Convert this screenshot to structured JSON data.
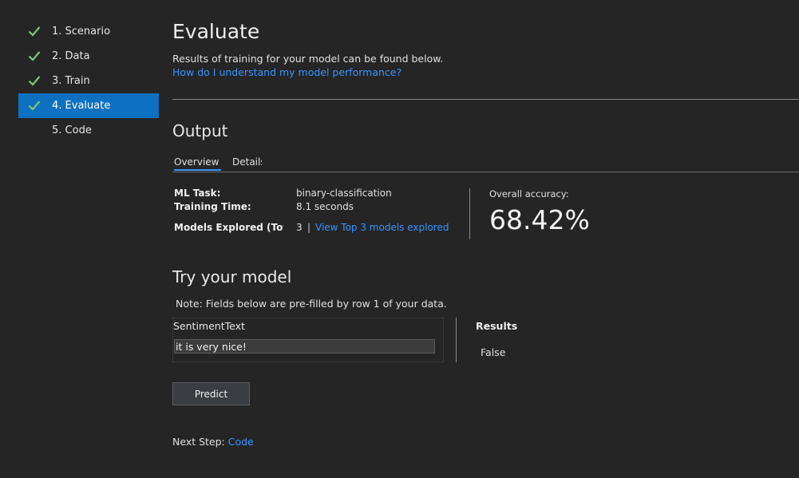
{
  "sidebar": {
    "steps": [
      {
        "label": "1. Scenario",
        "done": true
      },
      {
        "label": "2. Data",
        "done": true
      },
      {
        "label": "3. Train",
        "done": true
      },
      {
        "label": "4. Evaluate",
        "done": true,
        "active": true
      },
      {
        "label": "5. Code",
        "done": false
      }
    ],
    "check_color": "#7ec67e",
    "active_color": "#0e70c0"
  },
  "header": {
    "title": "Evaluate",
    "intro": "Results of training for your model can be found below.",
    "help_link": "How do I understand my model performance?"
  },
  "output": {
    "title": "Output",
    "tabs": [
      {
        "label": "Overview",
        "selected": true
      },
      {
        "label": "Details",
        "selected": false
      }
    ],
    "ml_task_label": "ML Task:",
    "ml_task_value": "binary-classification",
    "training_time_label": "Training Time:",
    "training_time_value": "8.1 seconds",
    "models_explored_label": "Models Explored (Total):",
    "models_explored_value": "3",
    "view_top_link": "View Top 3 models explored",
    "accuracy_label": "Overall accuracy:",
    "accuracy_value": "68.42%"
  },
  "try_model": {
    "title": "Try your model",
    "note": "Note: Fields below are pre-filled by row 1 of your data.",
    "field_label": "SentimentText",
    "field_value": "it is very nice!",
    "results_title": "Results",
    "results_value": "False",
    "predict_label": "Predict"
  },
  "next_step": {
    "prefix": "Next Step: ",
    "link": "Code"
  },
  "colors": {
    "background": "#252526",
    "link": "#3794ff"
  }
}
